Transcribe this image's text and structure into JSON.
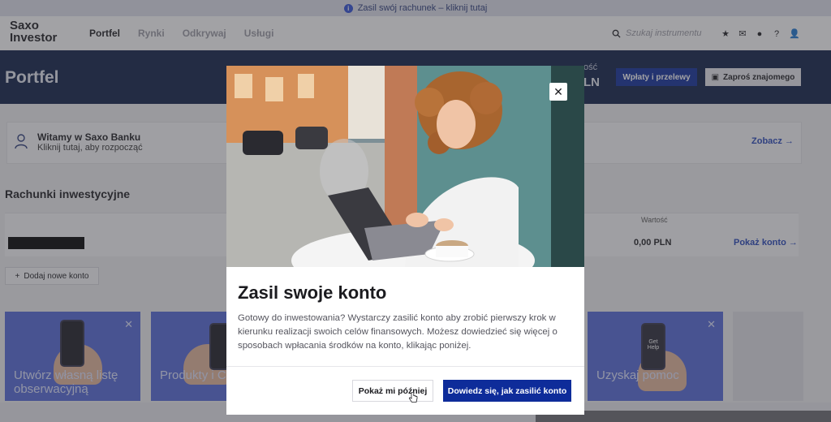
{
  "banner": {
    "text": "Zasil swój rachunek – kliknij tutaj"
  },
  "nav": {
    "logo": "Saxo Investor",
    "items": [
      {
        "label": "Portfel",
        "active": true
      },
      {
        "label": "Rynki",
        "active": false
      },
      {
        "label": "Odkrywaj",
        "active": false
      },
      {
        "label": "Usługi",
        "active": false
      }
    ],
    "search_placeholder": "Szukaj instrumentu",
    "icons": [
      "star-icon",
      "mail-icon",
      "notification-icon",
      "help-icon",
      "user-icon"
    ]
  },
  "header": {
    "title": "Portfel",
    "value_label": "ość",
    "value_amount": "LN",
    "deposit_button": "Wpłaty i przelewy",
    "invite_button": "Zaproś znajomego"
  },
  "welcome": {
    "title": "Witamy w Saxo Banku",
    "subtitle": "Kliknij tutaj, aby rozpocząć",
    "link": "Zobacz"
  },
  "accounts": {
    "title": "Rachunki inwestycyjne",
    "value_header": "Wartość",
    "amount": "0,00 PLN",
    "show_link": "Pokaż konto",
    "add_button": "Dodaj nowe konto"
  },
  "promos": [
    {
      "text": "Utwórz własną listę obserwacyjną"
    },
    {
      "text": "Produkty i C"
    },
    {
      "text": "Uzyskaj pomoc"
    }
  ],
  "phone_screen_text": "Get Help",
  "modal": {
    "title": "Zasil swoje konto",
    "body": "Gotowy do inwestowania? Wystarczy zasilić konto aby zrobić pierwszy krok w kierunku realizacji swoich celów finansowych. Możesz dowiedzieć się więcej o sposobach wpłacania środków na konto, klikając poniżej.",
    "later_button": "Pokaż mi później",
    "learn_button": "Dowiedz się, jak zasilić konto"
  },
  "colors": {
    "navy": "#0d1e46",
    "brand_blue": "#0e2c9a",
    "link_blue": "#2444b8",
    "promo_blue": "#5468d8"
  }
}
